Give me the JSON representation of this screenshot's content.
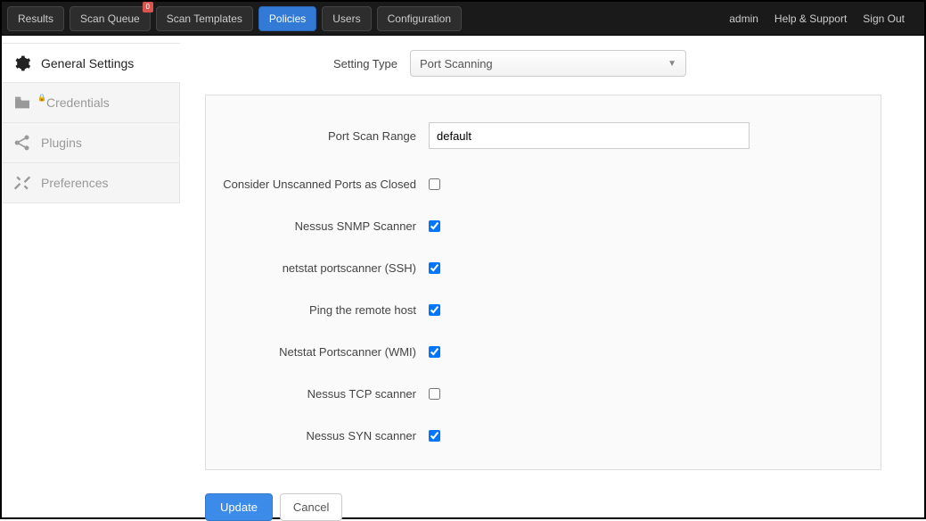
{
  "topnav": {
    "items": [
      {
        "label": "Results",
        "active": false,
        "badge": null
      },
      {
        "label": "Scan Queue",
        "active": false,
        "badge": "0"
      },
      {
        "label": "Scan Templates",
        "active": false,
        "badge": null
      },
      {
        "label": "Policies",
        "active": true,
        "badge": null
      },
      {
        "label": "Users",
        "active": false,
        "badge": null
      },
      {
        "label": "Configuration",
        "active": false,
        "badge": null
      }
    ],
    "right": {
      "user": "admin",
      "help": "Help & Support",
      "signout": "Sign Out"
    }
  },
  "sidebar": {
    "items": [
      {
        "label": "General Settings",
        "icon": "gear",
        "active": true,
        "locked": false
      },
      {
        "label": "Credentials",
        "icon": "folder",
        "active": false,
        "locked": true
      },
      {
        "label": "Plugins",
        "icon": "share",
        "active": false,
        "locked": false
      },
      {
        "label": "Preferences",
        "icon": "tools",
        "active": false,
        "locked": false
      }
    ]
  },
  "setting_type": {
    "label": "Setting Type",
    "value": "Port Scanning"
  },
  "form": {
    "port_scan_range": {
      "label": "Port Scan Range",
      "value": "default"
    },
    "options": [
      {
        "label": "Consider Unscanned Ports as Closed",
        "checked": false
      },
      {
        "label": "Nessus SNMP Scanner",
        "checked": true
      },
      {
        "label": "netstat portscanner (SSH)",
        "checked": true
      },
      {
        "label": "Ping the remote host",
        "checked": true
      },
      {
        "label": "Netstat Portscanner (WMI)",
        "checked": true
      },
      {
        "label": "Nessus TCP scanner",
        "checked": false
      },
      {
        "label": "Nessus SYN scanner",
        "checked": true
      }
    ]
  },
  "buttons": {
    "update": "Update",
    "cancel": "Cancel"
  }
}
